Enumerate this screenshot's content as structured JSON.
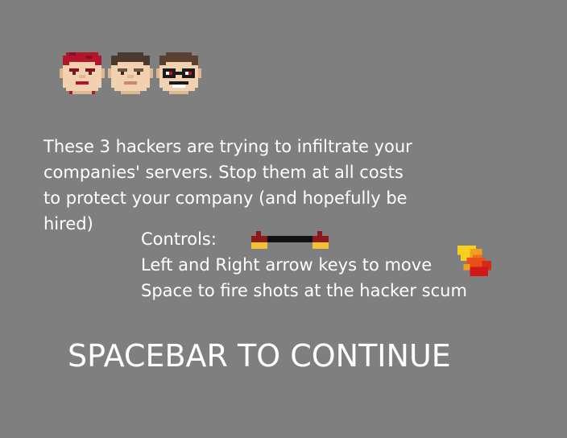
{
  "intro_text": "These 3 hackers are trying to infiltrate your\ncompanies' servers. Stop them at all costs\nto protect your company (and hopefully be\nhired)",
  "controls": {
    "heading": "Controls:",
    "move_line": "Left and Right arrow keys to move",
    "fire_line": "Space to fire shots at the hacker scum"
  },
  "continue_prompt": "SPACEBAR TO CONTINUE",
  "colors": {
    "background": "#7f7f7f",
    "text": "#ffffff"
  },
  "icons": [
    "hacker-red-hair-icon",
    "hacker-brown-hair-icon",
    "hacker-glasses-icon",
    "player-paddle-icon",
    "fireball-shot-icon"
  ]
}
